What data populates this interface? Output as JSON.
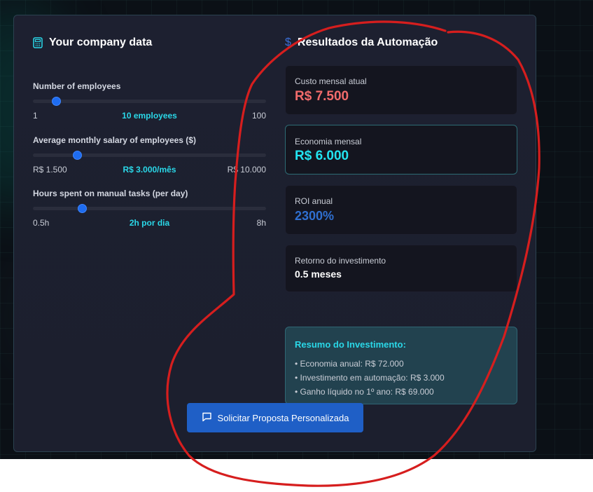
{
  "left": {
    "title": "Your company data",
    "title_icon": "calculator-icon",
    "fields": [
      {
        "label": "Number of employees",
        "min": "1",
        "max": "100",
        "current": "10 employees",
        "fraction": 0.1
      },
      {
        "label": "Average monthly salary of employees ($)",
        "min": "R$ 1.500",
        "max": "R$ 10.000",
        "current": "R$ 3.000/mês",
        "fraction": 0.19
      },
      {
        "label": "Hours spent on manual tasks (per day)",
        "min": "0.5h",
        "max": "8h",
        "current": "2h por dia",
        "fraction": 0.21
      }
    ]
  },
  "right": {
    "title": "Resultados da Automação",
    "title_icon": "dollar-icon",
    "stats": [
      {
        "label": "Custo mensal atual",
        "value": "R$ 7.500",
        "color": "#f26b6b"
      },
      {
        "label": "Economia mensal",
        "value": "R$ 6.000",
        "color": "#22e3f0"
      },
      {
        "label": "ROI anual",
        "value": "2300%",
        "color": "#2f6fd0"
      },
      {
        "label": "Retorno do investimento",
        "value": "0.5 meses",
        "color": "#ffffff"
      }
    ],
    "summary": {
      "title": "Resumo do Investimento:",
      "items": [
        "• Economia anual: R$ 72.000",
        "• Investimento em automação: R$ 3.000",
        "• Ganho líquido no 1º ano: R$ 69.000"
      ]
    }
  },
  "cta": {
    "label": "Solicitar Proposta Personalizada",
    "icon": "message-icon",
    "color": "#1f5fc6"
  },
  "annotation": {
    "color": "#d61e1e"
  }
}
